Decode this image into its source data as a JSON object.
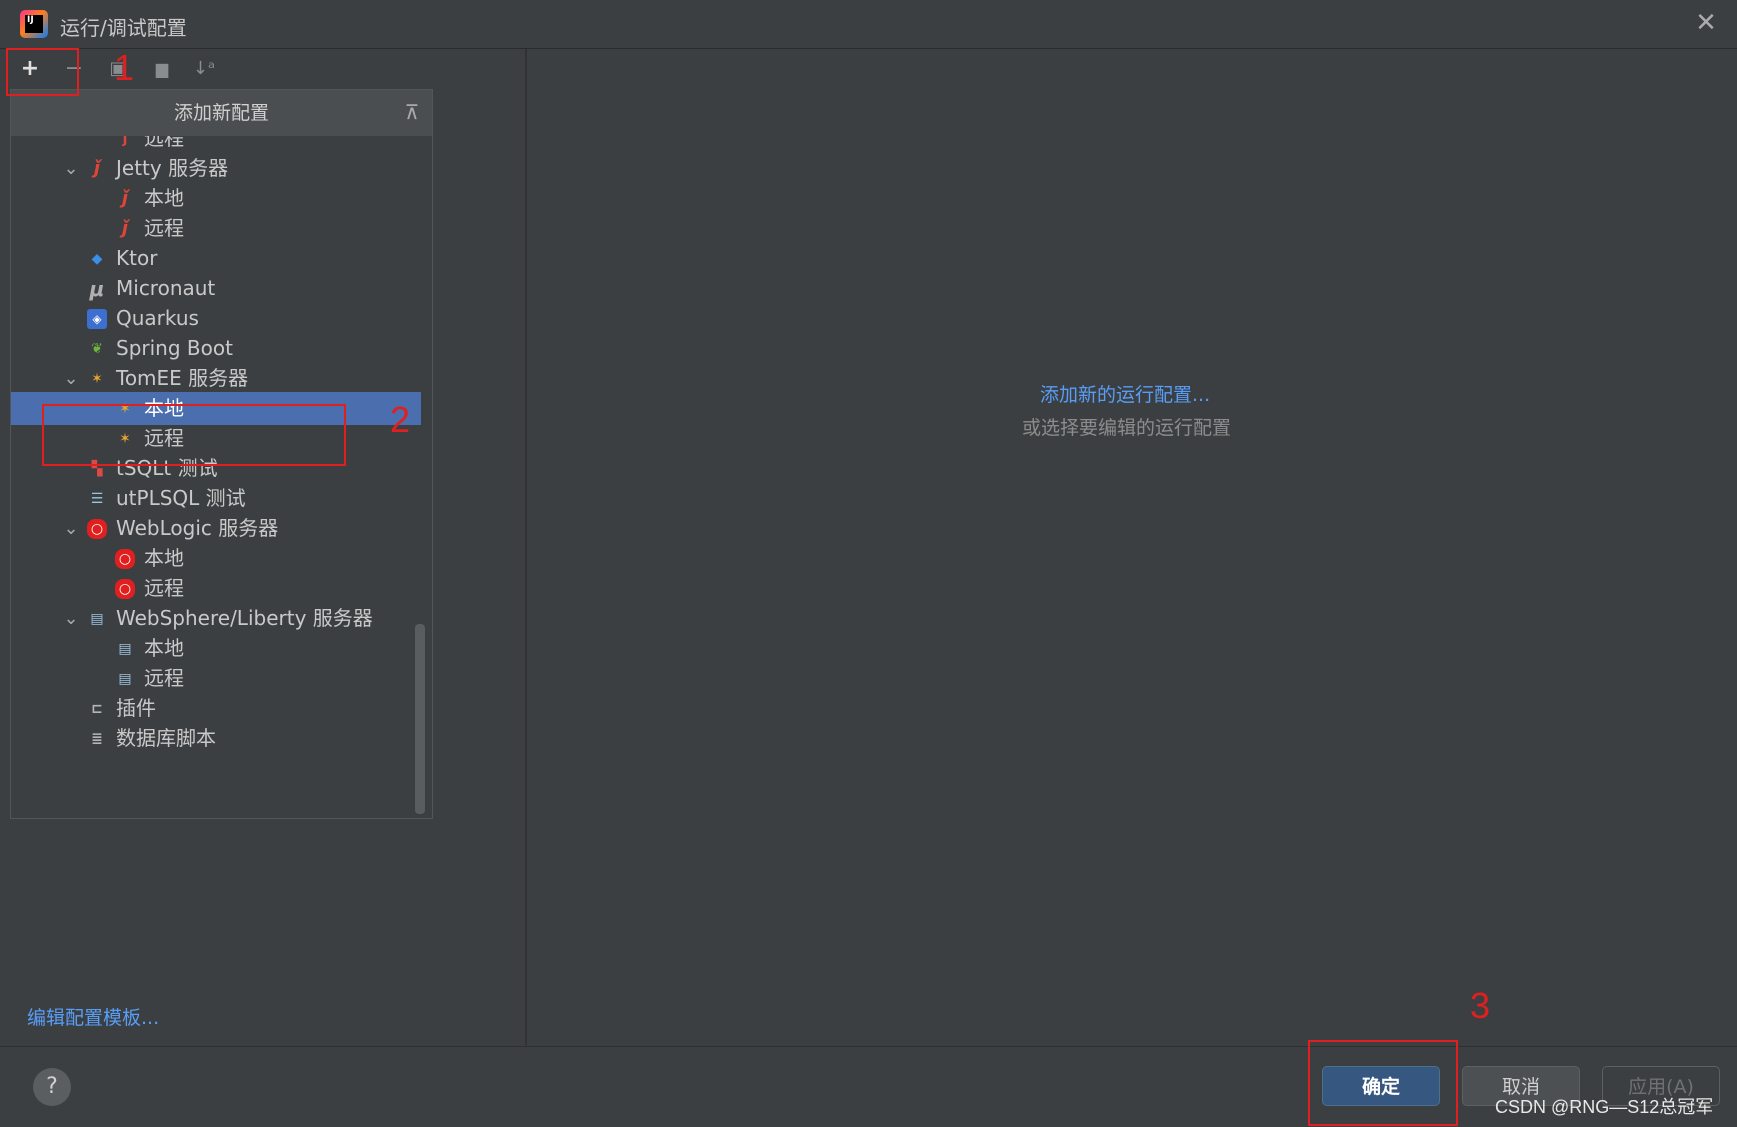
{
  "window": {
    "title": "运行/调试配置",
    "app_icon": "intellij-idea-icon",
    "close_icon": "close-icon"
  },
  "toolbar": {
    "add": "+",
    "remove": "−",
    "copy": "▣",
    "folder": "▆",
    "sort": "↓ᵃ"
  },
  "popup": {
    "header": "添加新配置",
    "collapse_icon": "collapse-all-icon",
    "partial_item": "远程",
    "items": [
      {
        "label": "Jetty 服务器",
        "icon": "jetty-icon",
        "expanded": true
      },
      {
        "label": "本地",
        "icon": "jetty-icon"
      },
      {
        "label": "远程",
        "icon": "jetty-icon"
      },
      {
        "label": "Ktor",
        "icon": "ktor-icon"
      },
      {
        "label": "Micronaut",
        "icon": "micronaut-icon"
      },
      {
        "label": "Quarkus",
        "icon": "quarkus-icon"
      },
      {
        "label": "Spring Boot",
        "icon": "spring-boot-icon"
      },
      {
        "label": "TomEE 服务器",
        "icon": "tomee-icon",
        "expanded": true
      },
      {
        "label": "本地",
        "icon": "tomee-icon",
        "selected": true
      },
      {
        "label": "远程",
        "icon": "tomee-icon"
      },
      {
        "label": "tSQLt 测试",
        "icon": "tsqlt-icon"
      },
      {
        "label": "utPLSQL 测试",
        "icon": "utplsql-icon"
      },
      {
        "label": "WebLogic 服务器",
        "icon": "weblogic-icon",
        "expanded": true
      },
      {
        "label": "本地",
        "icon": "weblogic-icon"
      },
      {
        "label": "远程",
        "icon": "weblogic-icon"
      },
      {
        "label": "WebSphere/Liberty 服务器",
        "icon": "websphere-icon",
        "expanded": true
      },
      {
        "label": "本地",
        "icon": "websphere-icon"
      },
      {
        "label": "远程",
        "icon": "websphere-icon"
      },
      {
        "label": "插件",
        "icon": "plugin-icon"
      },
      {
        "label": "数据库脚本",
        "icon": "database-script-icon"
      }
    ]
  },
  "left_footer": {
    "edit_templates": "编辑配置模板..."
  },
  "main": {
    "placeholder_link": "添加新的运行配置...",
    "placeholder_sub": "或选择要编辑的运行配置"
  },
  "footer": {
    "help": "?",
    "ok": "确定",
    "cancel": "取消",
    "apply": "应用(A)"
  },
  "annotations": {
    "n1": "1",
    "n2": "2",
    "n3": "3"
  },
  "watermark": "CSDN @RNG—S12总冠军",
  "colors": {
    "background": "#3c3f41",
    "selection": "#4b6eaf",
    "link": "#589df6",
    "annotation": "#e02020",
    "ok_button": "#365880"
  }
}
